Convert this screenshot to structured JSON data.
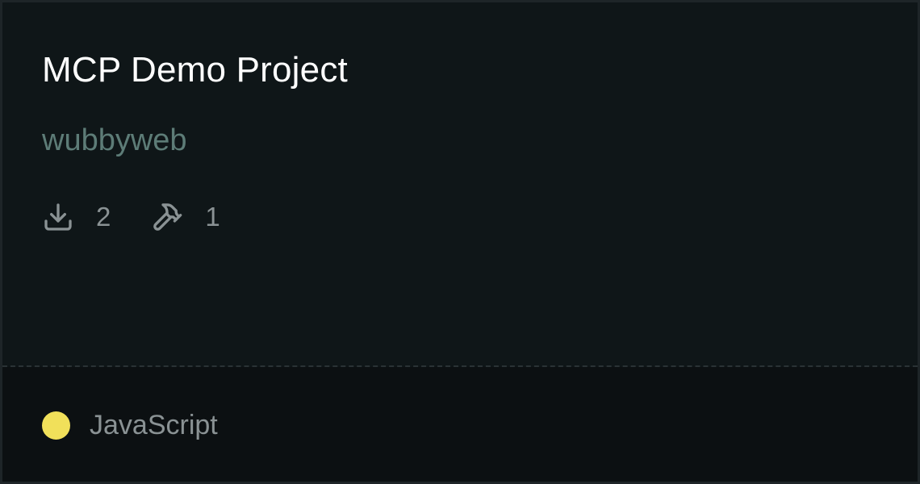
{
  "card": {
    "title": "MCP Demo Project",
    "author": "wubbyweb",
    "stats": {
      "downloads": {
        "icon": "download-icon",
        "value": "2"
      },
      "tools": {
        "icon": "hammer-icon",
        "value": "1"
      }
    },
    "language": {
      "name": "JavaScript",
      "color": "#f1e05a"
    }
  }
}
